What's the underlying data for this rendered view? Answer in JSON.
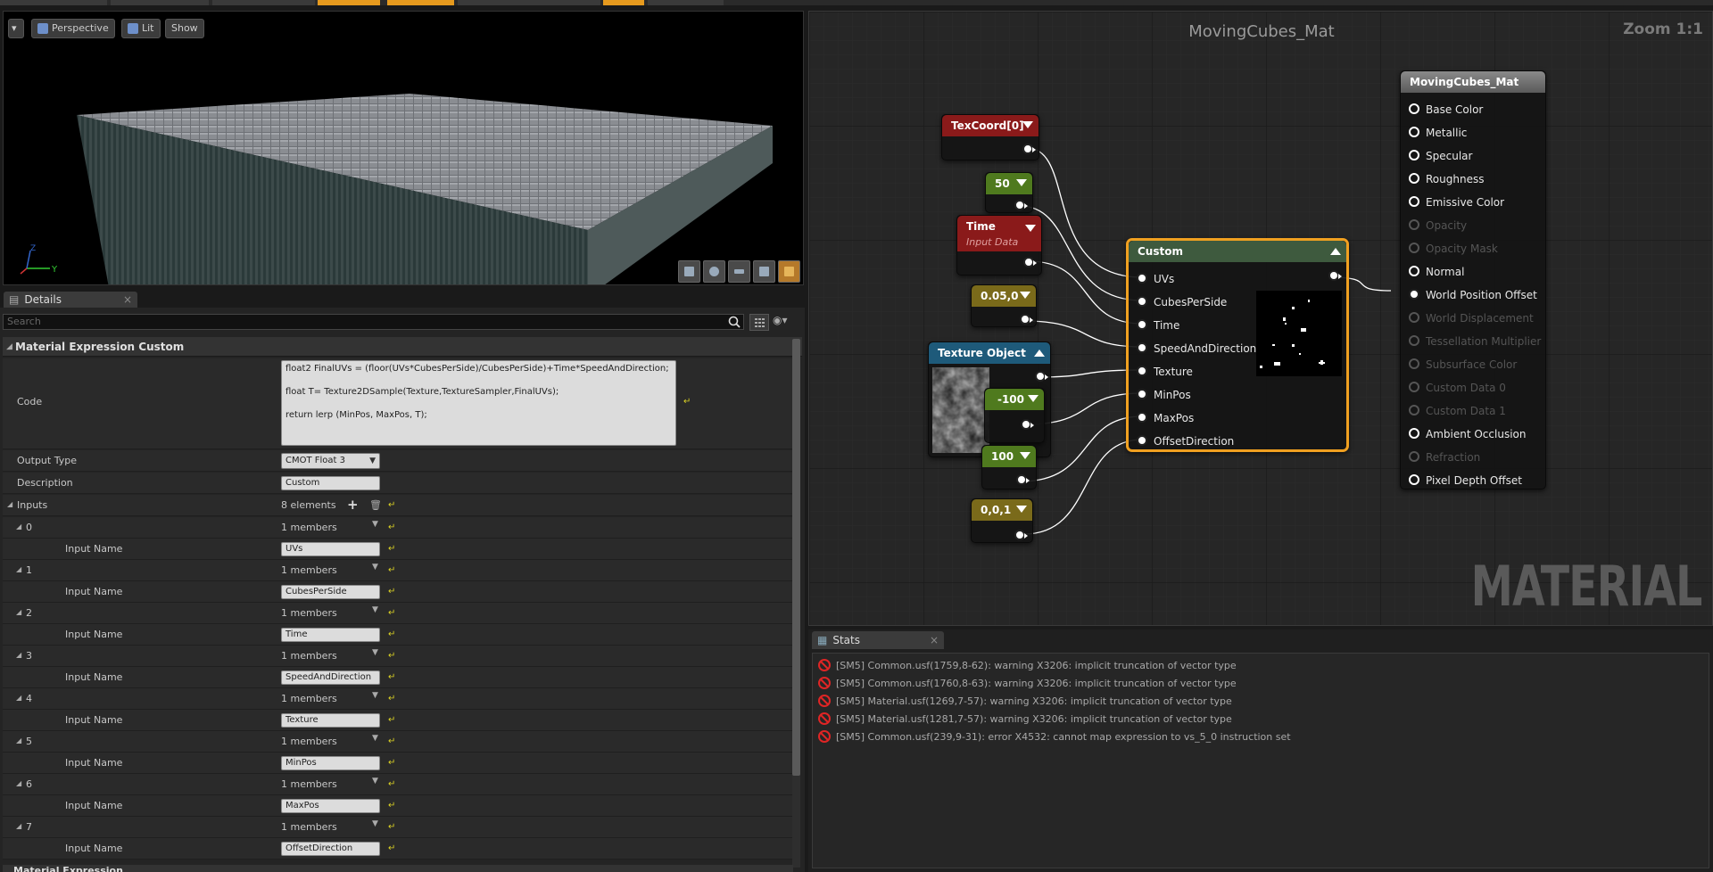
{
  "viewport": {
    "perspective_label": "Perspective",
    "lit_label": "Lit",
    "show_label": "Show"
  },
  "details": {
    "tab_label": "Details",
    "search_placeholder": "Search",
    "category_title": "Material Expression Custom",
    "code_label": "Code",
    "code_lines": [
      "float2 FinalUVs = (floor(UVs*CubesPerSide)/CubesPerSide)+Time*SpeedAndDirection;",
      "float T= Texture2DSample(Texture,TextureSampler,FinalUVs);",
      "return lerp (MinPos, MaxPos, T);"
    ],
    "output_type_label": "Output Type",
    "output_type_value": "CMOT Float 3",
    "description_label": "Description",
    "description_value": "Custom",
    "inputs_label": "Inputs",
    "inputs_count": "8 elements",
    "input_name_label": "Input Name",
    "inputs": [
      {
        "index": "0",
        "members": "1 members",
        "name": "UVs"
      },
      {
        "index": "1",
        "members": "1 members",
        "name": "CubesPerSide"
      },
      {
        "index": "2",
        "members": "1 members",
        "name": "Time"
      },
      {
        "index": "3",
        "members": "1 members",
        "name": "SpeedAndDirection"
      },
      {
        "index": "4",
        "members": "1 members",
        "name": "Texture"
      },
      {
        "index": "5",
        "members": "1 members",
        "name": "MinPos"
      },
      {
        "index": "6",
        "members": "1 members",
        "name": "MaxPos"
      },
      {
        "index": "7",
        "members": "1 members",
        "name": "OffsetDirection"
      }
    ],
    "next_category": "Material Expression"
  },
  "graph": {
    "title": "MovingCubes_Mat",
    "zoom": "Zoom 1:1",
    "watermark": "MATERIAL",
    "nodes": {
      "texcoord": "TexCoord[0]",
      "const_50": "50",
      "time": "Time",
      "time_sub": "Input Data",
      "speed": "0.05,0",
      "texobj": "Texture Object",
      "minpos": "-100",
      "maxpos": "100",
      "offset": "0,0,1",
      "custom": "Custom",
      "custom_inputs": [
        "UVs",
        "CubesPerSide",
        "Time",
        "SpeedAndDirection",
        "Texture",
        "MinPos",
        "MaxPos",
        "OffsetDirection"
      ],
      "result_title": "MovingCubes_Mat",
      "result_pins": [
        {
          "label": "Base Color",
          "active": true
        },
        {
          "label": "Metallic",
          "active": true
        },
        {
          "label": "Specular",
          "active": true
        },
        {
          "label": "Roughness",
          "active": true
        },
        {
          "label": "Emissive Color",
          "active": true
        },
        {
          "label": "Opacity",
          "active": false
        },
        {
          "label": "Opacity Mask",
          "active": false
        },
        {
          "label": "Normal",
          "active": true
        },
        {
          "label": "World Position Offset",
          "active": true
        },
        {
          "label": "World Displacement",
          "active": false
        },
        {
          "label": "Tessellation Multiplier",
          "active": false
        },
        {
          "label": "Subsurface Color",
          "active": false
        },
        {
          "label": "Custom Data 0",
          "active": false
        },
        {
          "label": "Custom Data 1",
          "active": false
        },
        {
          "label": "Ambient Occlusion",
          "active": true
        },
        {
          "label": "Refraction",
          "active": false
        },
        {
          "label": "Pixel Depth Offset",
          "active": true
        }
      ]
    },
    "colors": {
      "texcoord_header": "#8a1a1a",
      "const_header": "#4f7a1e",
      "time_header": "#8a1a1a",
      "vector_header": "#7a6a1a",
      "texobj_header": "#1e5a7a",
      "custom_header": "#3e5a3e",
      "result_header": "#6a6a6a",
      "selection": "#f0a020"
    }
  },
  "stats": {
    "tab_label": "Stats",
    "messages": [
      "[SM5] Common.usf(1759,8-62):  warning X3206: implicit truncation of vector type",
      "[SM5] Common.usf(1760,8-63):  warning X3206: implicit truncation of vector type",
      "[SM5] Material.usf(1269,7-57):  warning X3206: implicit truncation of vector type",
      "[SM5] Material.usf(1281,7-57):  warning X3206: implicit truncation of vector type",
      "[SM5] Common.usf(239,9-31):  error X4532: cannot map expression to vs_5_0 instruction set"
    ]
  }
}
